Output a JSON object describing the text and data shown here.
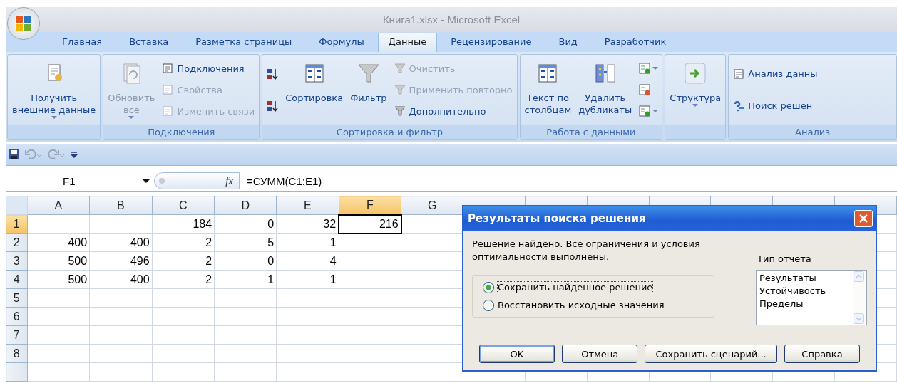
{
  "window": {
    "title": "Книга1.xlsx - Microsoft Excel"
  },
  "tabs": [
    {
      "label": "Главная",
      "selected": false
    },
    {
      "label": "Вставка",
      "selected": false
    },
    {
      "label": "Разметка страницы",
      "selected": false
    },
    {
      "label": "Формулы",
      "selected": false
    },
    {
      "label": "Данные",
      "selected": true
    },
    {
      "label": "Рецензирование",
      "selected": false
    },
    {
      "label": "Вид",
      "selected": false
    },
    {
      "label": "Разработчик",
      "selected": false
    }
  ],
  "ribbon": [
    {
      "items": [
        {
          "kind": "large",
          "label": "Получить\nвнешние данные",
          "dropdown": true,
          "disabled": false
        }
      ]
    },
    {
      "label": "Подключения",
      "items": [
        {
          "kind": "large",
          "label": "Обновить\nвсе",
          "dropdown": true,
          "disabled": true
        },
        {
          "kind": "stack",
          "items": [
            {
              "label": "Подключения",
              "disabled": false
            },
            {
              "label": "Свойства",
              "disabled": true
            },
            {
              "label": "Изменить связи",
              "disabled": true
            }
          ]
        }
      ]
    },
    {
      "label": "Сортировка и фильтр",
      "items": [
        {
          "kind": "icons",
          "items": [
            {
              "dropdown": false
            },
            {
              "dropdown": false
            }
          ]
        },
        {
          "kind": "large",
          "label": "Сортировка",
          "dropdown": false,
          "disabled": false
        },
        {
          "kind": "large",
          "label": "Фильтр",
          "dropdown": false,
          "disabled": false
        },
        {
          "kind": "stack",
          "items": [
            {
              "label": "Очистить",
              "disabled": true
            },
            {
              "label": "Применить повторно",
              "disabled": true
            },
            {
              "label": "Дополнительно",
              "disabled": false
            }
          ]
        }
      ]
    },
    {
      "label": "Работа с данными",
      "items": [
        {
          "kind": "large",
          "label": "Текст по\nстолбцам",
          "dropdown": false,
          "disabled": false
        },
        {
          "kind": "large",
          "label": "Удалить\nдубликаты",
          "dropdown": false,
          "disabled": false
        },
        {
          "kind": "icons",
          "items": [
            {
              "dropdown": true
            },
            {
              "dropdown": false
            },
            {
              "dropdown": true
            }
          ]
        }
      ]
    },
    {
      "items": [
        {
          "kind": "large",
          "label": "Структура",
          "dropdown": true,
          "disabled": false
        }
      ]
    },
    {
      "label": "Анализ",
      "items": [
        {
          "kind": "stack",
          "items": [
            {
              "label": "Анализ данны",
              "disabled": false
            },
            {
              "label": "Поиск решен",
              "disabled": false
            }
          ]
        }
      ]
    }
  ],
  "formula_bar": {
    "name_box": "F1",
    "fx": "fx",
    "formula": "=СУММ(C1:E1)"
  },
  "sheet": {
    "columns": [
      {
        "label": "A",
        "selected": false
      },
      {
        "label": "B",
        "selected": false
      },
      {
        "label": "C",
        "selected": false
      },
      {
        "label": "D",
        "selected": false
      },
      {
        "label": "E",
        "selected": false
      },
      {
        "label": "F",
        "selected": true
      },
      {
        "label": "G",
        "selected": false
      }
    ],
    "rows": [
      {
        "label": "1",
        "selected": true,
        "cells": [
          "",
          "",
          "184",
          "0",
          "32",
          "216",
          ""
        ],
        "active": [
          false,
          false,
          false,
          false,
          false,
          true,
          false
        ]
      },
      {
        "label": "2",
        "selected": false,
        "cells": [
          "400",
          "400",
          "2",
          "5",
          "1",
          "",
          ""
        ]
      },
      {
        "label": "3",
        "selected": false,
        "cells": [
          "500",
          "496",
          "2",
          "0",
          "4",
          "",
          ""
        ]
      },
      {
        "label": "4",
        "selected": false,
        "cells": [
          "500",
          "400",
          "2",
          "1",
          "1",
          "",
          ""
        ]
      },
      {
        "label": "5",
        "selected": false,
        "cells": [
          "",
          "",
          "",
          "",
          "",
          "",
          ""
        ]
      },
      {
        "label": "6",
        "selected": false,
        "cells": [
          "",
          "",
          "",
          "",
          "",
          "",
          ""
        ]
      },
      {
        "label": "7",
        "selected": false,
        "cells": [
          "",
          "",
          "",
          "",
          "",
          "",
          ""
        ]
      },
      {
        "label": "8",
        "selected": false,
        "cells": [
          "",
          "",
          "",
          "",
          "",
          "",
          ""
        ]
      }
    ]
  },
  "dialog": {
    "title": "Результаты поиска решения",
    "message": "Решение найдено. Все ограничения и условия оптимальности выполнены.",
    "options": [
      {
        "label": "Сохранить найденное решение",
        "selected": true
      },
      {
        "label": "Восстановить исходные значения",
        "selected": false
      }
    ],
    "report_type": {
      "label": "Тип отчета",
      "items": [
        {
          "label": "Результаты",
          "selected": false
        },
        {
          "label": "Устойчивость",
          "selected": false
        },
        {
          "label": "Пределы",
          "selected": false
        }
      ]
    },
    "buttons": [
      {
        "label": "OK",
        "default": true
      },
      {
        "label": "Отмена",
        "default": false
      },
      {
        "label": "Сохранить сценарий...",
        "default": false
      },
      {
        "label": "Справка",
        "default": false
      }
    ]
  }
}
